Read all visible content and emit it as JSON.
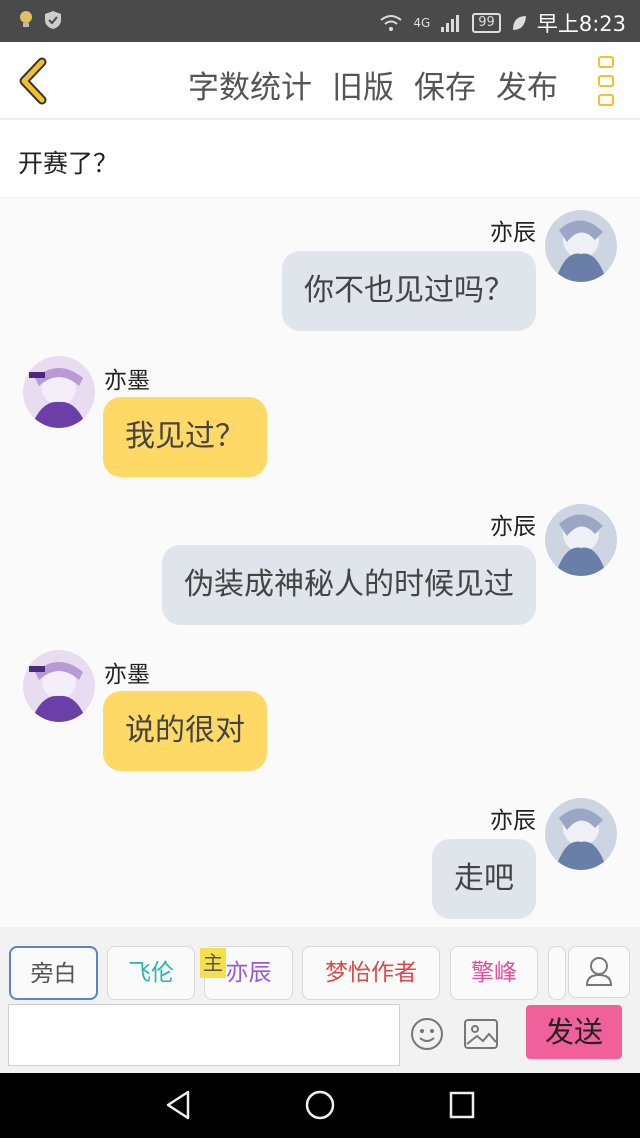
{
  "status_bar": {
    "network": "4G",
    "battery": "99",
    "time": "早上8:23"
  },
  "toolbar": {
    "actions": [
      "字数统计",
      "旧版",
      "保存",
      "发布"
    ],
    "accent": "#f3c12a"
  },
  "story": {
    "title": "开赛了？"
  },
  "messages": [
    {
      "sender": "亦辰",
      "side": "right",
      "text": "你不也见过吗？"
    },
    {
      "sender": "亦墨",
      "side": "left",
      "text": "我见过？"
    },
    {
      "sender": "亦辰",
      "side": "right",
      "text": "伪装成神秘人的时候见过"
    },
    {
      "sender": "亦墨",
      "side": "left",
      "text": "说的很对"
    },
    {
      "sender": "亦辰",
      "side": "right",
      "text": "走吧"
    }
  ],
  "roles": [
    {
      "label": "旁白",
      "color": "#555555"
    },
    {
      "label": "飞伦",
      "color": "#2bb5b0"
    },
    {
      "label": "亦辰",
      "color": "#9b59d0"
    },
    {
      "label": "梦怡作者",
      "color": "#d94a4a"
    },
    {
      "label": "擎峰",
      "color": "#e050a0"
    }
  ],
  "host_badge": "主",
  "composer": {
    "placeholder": "",
    "send_label": "发送"
  }
}
